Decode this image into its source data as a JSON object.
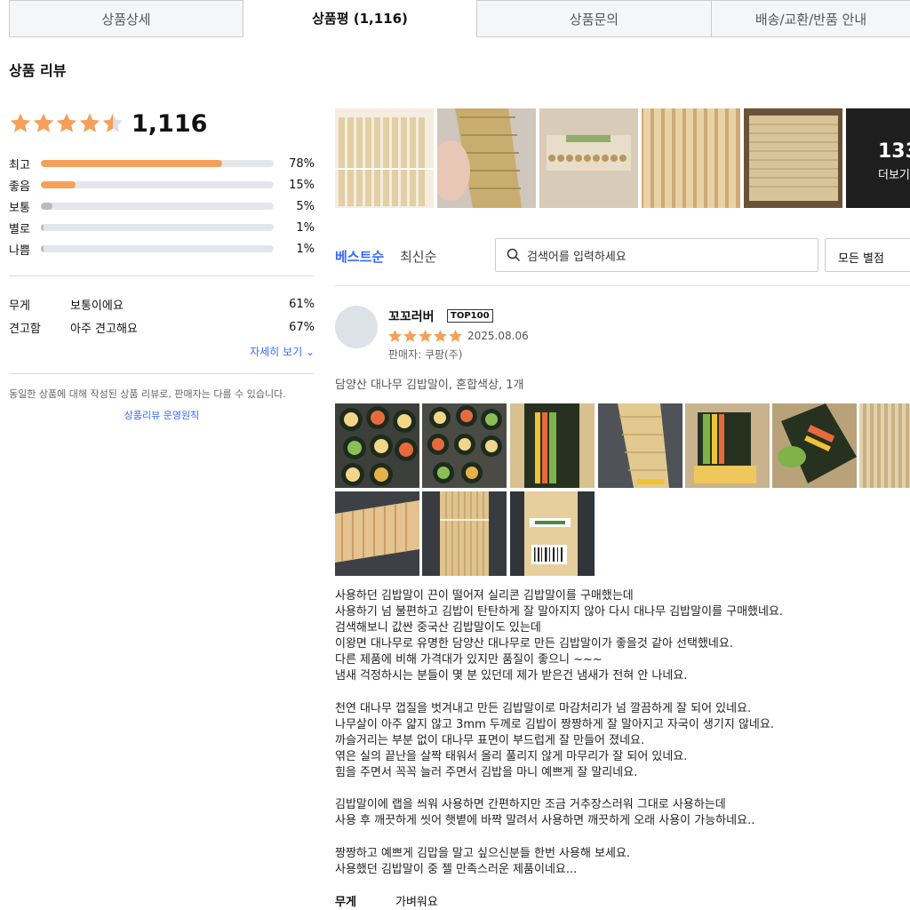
{
  "tabs": [
    {
      "label": "상품상세"
    },
    {
      "label": "상품평 (1,116)"
    },
    {
      "label": "상품문의"
    },
    {
      "label": "배송/교환/반품 안내"
    }
  ],
  "section_title": "상품 리뷰",
  "summary": {
    "rating": 4.5,
    "count": "1,116",
    "distribution": [
      {
        "label": "최고",
        "percent_text": "78%",
        "value": 78,
        "color": "#f5a05a"
      },
      {
        "label": "좋음",
        "percent_text": "15%",
        "value": 15,
        "color": "#f5a05a"
      },
      {
        "label": "보통",
        "percent_text": "5%",
        "value": 5,
        "color": "#b6bcc5"
      },
      {
        "label": "별로",
        "percent_text": "1%",
        "value": 1,
        "color": "#b6bcc5"
      },
      {
        "label": "나쁨",
        "percent_text": "1%",
        "value": 1,
        "color": "#b6bcc5"
      }
    ],
    "attributes": [
      {
        "name": "무게",
        "value": "보통이에요",
        "percent": "61%"
      },
      {
        "name": "견고함",
        "value": "아주 견고해요",
        "percent": "67%"
      }
    ],
    "more_link": "자세히 보기",
    "notice": "동일한 상품에 대해 작성된 상품 리뷰로, 판매자는 다를 수 있습니다.",
    "policy_link": "상품리뷰 운영원칙"
  },
  "photo_strip": {
    "more_count": "133",
    "more_label": "더보기"
  },
  "sort": {
    "best": "베스트순",
    "newest": "최신순"
  },
  "search": {
    "placeholder": "검색어를 입력하세요"
  },
  "star_filter": {
    "label": "모든 별점"
  },
  "review": {
    "nickname": "꼬꼬러버",
    "badge": "TOP100",
    "rating": 5,
    "date": "2025.08.06",
    "seller": "판매자: 쿠팡(주)",
    "option": "담양산 대나무 김밥말이, 혼합색상, 1개",
    "body": "사용하던 김밥말이 끈이 떨어져 실리콘 김밥말이를 구매했는데\n사용하기 넘 불편하고 김밥이 탄탄하게 잘 말아지지 않아 다시 대나무 김밥말이를 구매했네요.\n검색해보니 값싼 중국산 김밥말이도 있는데\n이왕면 대나무로 유명한 담양산 대나무로 만든 김밥말이가 좋을것 같아 선택했네요.\n다른 제품에 비해 가격대가 있지만 품질이 좋으니 ~~~\n냄새 걱정하시는 분들이 몇 분 있던데 제가 받은건 냄새가 전혀 안 나네요.\n\n천연 대나무 껍질을 벗겨내고 만든 김밥말이로 마감처리가 넘 깔끔하게 잘 되어 있네요.\n나무살이 아주 얇지 않고 3mm 두께로 김밥이 짱짱하게 잘 말아지고 자국이 생기지 않네요.\n까슬거리는 부분 없이 대나무 표면이 부드럽게 잘 만들어 졌네요.\n엮은 실의 끝난을 살짝 태워서 올리 풀리지 않게 마무리가 잘 되어 있네요.\n힘을 주면서 꼭꼭 늘러 주면서 김밥을 마니 예쁘게 잘 말리네요.\n\n김밥말이에 랩을 씌워 사용하면 간편하지만 조금 거추장스러워 그대로 사용하는데\n사용 후 깨끗하게 씻어 햇볕에 바짝 말려서 사용하면 깨끗하게 오래 사용이 가능하네요..\n\n짱짱하고 예쁘게 김맙을 말고 싶으신분들 한번 사용해 보세요.\n사용했던 김밥말이 중 젤 만족스러운 제품이네요...",
    "weight_label": "무게",
    "weight_value": "가벼워요"
  },
  "colors": {
    "accent": "#346aff",
    "star": "#f5a05a",
    "bar_gray": "#b6bcc5"
  }
}
